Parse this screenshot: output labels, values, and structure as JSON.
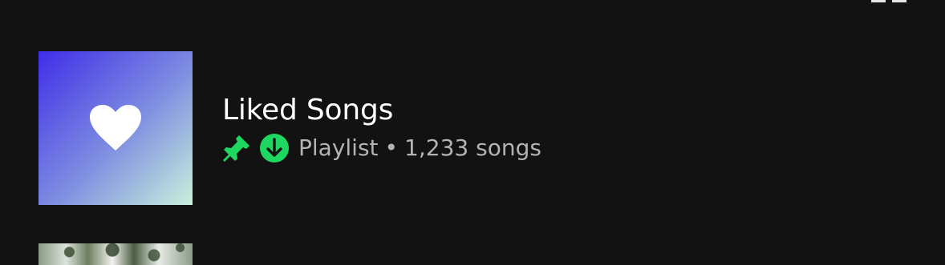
{
  "library": {
    "items": [
      {
        "title": "Liked Songs",
        "pinned_icon": "pin-icon",
        "downloaded_icon": "download-icon",
        "artwork_icon": "heart-icon",
        "type": "Playlist",
        "separator": "•",
        "count": "1,233 songs",
        "colors": {
          "gradient_start": "#3f2ee8",
          "gradient_end": "#c9f0dc",
          "accent_green": "#1ed760"
        }
      }
    ]
  },
  "top_edge_icon": "grid-icon",
  "next_item": {
    "artwork": "next-item-thumbnail"
  }
}
